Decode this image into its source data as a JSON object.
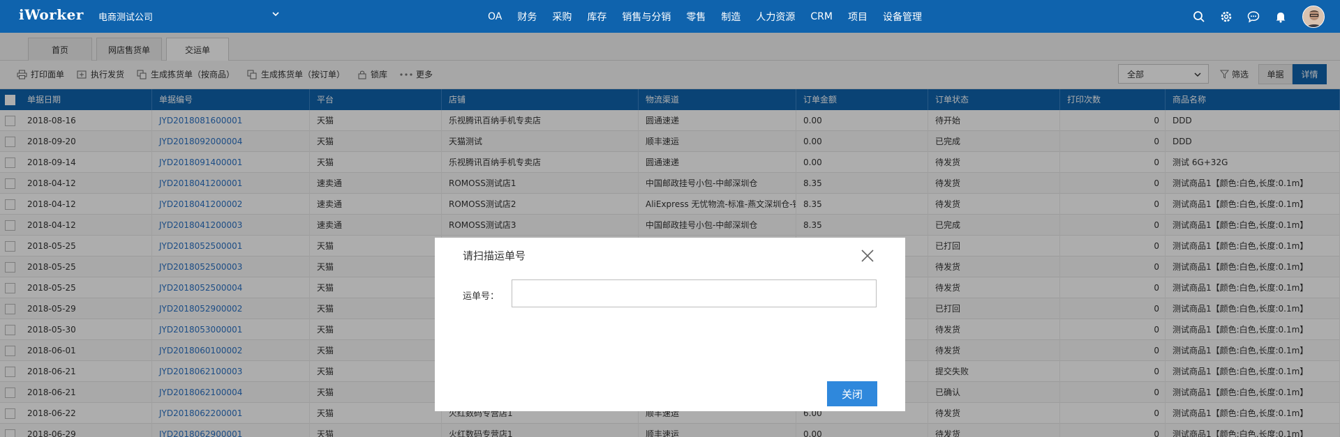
{
  "app": {
    "logo": "iWorker",
    "company": "电商测试公司"
  },
  "nav": [
    "OA",
    "财务",
    "采购",
    "库存",
    "销售与分销",
    "零售",
    "制造",
    "人力资源",
    "CRM",
    "项目",
    "设备管理"
  ],
  "tabs": [
    "首页",
    "网店售货单",
    "交运单"
  ],
  "toolbar": {
    "print": "打印面单",
    "ship": "执行发货",
    "pick_by_product": "生成拣货单（按商品）",
    "pick_by_order": "生成拣货单（按订单）",
    "lock": "锁库",
    "more": "更多",
    "filter_value": "全部",
    "screen": "筛选",
    "view_list": "单据",
    "view_detail": "详情"
  },
  "table": {
    "headers": [
      "单据日期",
      "单据编号",
      "平台",
      "店铺",
      "物流渠道",
      "订单金额",
      "订单状态",
      "打印次数",
      "商品名称"
    ],
    "rows": [
      [
        "2018-08-16",
        "JYD2018081600001",
        "天猫",
        "乐视腾讯百纳手机专卖店",
        "圆通速递",
        "0.00",
        "待开始",
        "0",
        "DDD"
      ],
      [
        "2018-09-20",
        "JYD2018092000004",
        "天猫",
        "天猫测试",
        "顺丰速运",
        "0.00",
        "已完成",
        "0",
        "DDD"
      ],
      [
        "2018-09-14",
        "JYD2018091400001",
        "天猫",
        "乐视腾讯百纳手机专卖店",
        "圆通速递",
        "0.00",
        "待发货",
        "0",
        "测试 6G+32G"
      ],
      [
        "2018-04-12",
        "JYD2018041200001",
        "速卖通",
        "ROMOSS测试店1",
        "中国邮政挂号小包-中邮深圳仓",
        "8.35",
        "待发货",
        "0",
        "测试商品1【颜色:白色,长度:0.1m】"
      ],
      [
        "2018-04-12",
        "JYD2018041200002",
        "速卖通",
        "ROMOSS测试店2",
        "AliExpress 无忧物流-标准-燕文深圳仓-钱",
        "8.35",
        "待发货",
        "0",
        "测试商品1【颜色:白色,长度:0.1m】"
      ],
      [
        "2018-04-12",
        "JYD2018041200003",
        "速卖通",
        "ROMOSS测试店3",
        "中国邮政挂号小包-中邮深圳仓",
        "8.35",
        "已完成",
        "0",
        "测试商品1【颜色:白色,长度:0.1m】"
      ],
      [
        "2018-05-25",
        "JYD2018052500001",
        "天猫",
        "",
        "",
        "",
        "已打回",
        "0",
        "测试商品1【颜色:白色,长度:0.1m】"
      ],
      [
        "2018-05-25",
        "JYD2018052500003",
        "天猫",
        "",
        "",
        "",
        "待发货",
        "0",
        "测试商品1【颜色:白色,长度:0.1m】"
      ],
      [
        "2018-05-25",
        "JYD2018052500004",
        "天猫",
        "",
        "",
        "",
        "待发货",
        "0",
        "测试商品1【颜色:白色,长度:0.1m】"
      ],
      [
        "2018-05-29",
        "JYD2018052900002",
        "天猫",
        "",
        "",
        "",
        "已打回",
        "0",
        "测试商品1【颜色:白色,长度:0.1m】"
      ],
      [
        "2018-05-30",
        "JYD2018053000001",
        "天猫",
        "",
        "",
        "",
        "待发货",
        "0",
        "测试商品1【颜色:白色,长度:0.1m】"
      ],
      [
        "2018-06-01",
        "JYD2018060100002",
        "天猫",
        "",
        "",
        "",
        "待发货",
        "0",
        "测试商品1【颜色:白色,长度:0.1m】"
      ],
      [
        "2018-06-21",
        "JYD2018062100003",
        "天猫",
        "",
        "",
        "",
        "提交失败",
        "0",
        "测试商品1【颜色:白色,长度:0.1m】"
      ],
      [
        "2018-06-21",
        "JYD2018062100004",
        "天猫",
        "",
        "",
        "",
        "已确认",
        "0",
        "测试商品1【颜色:白色,长度:0.1m】"
      ],
      [
        "2018-06-22",
        "JYD2018062200001",
        "天猫",
        "火红数码专营店1",
        "顺丰速运",
        "6.00",
        "待发货",
        "0",
        "测试商品1【颜色:白色,长度:0.1m】"
      ],
      [
        "2018-06-29",
        "JYD2018062900001",
        "天猫",
        "火红数码专营店1",
        "顺丰速运",
        "0.00",
        "待发货",
        "0",
        "测试商品1【颜色:白色,长度:0.1m】"
      ]
    ]
  },
  "modal": {
    "title": "请扫描运单号",
    "field_label": "运单号：",
    "field_value": "",
    "field_placeholder": "",
    "close_label": "关闭"
  },
  "colors": {
    "brand": "#0f63ad",
    "primary_button": "#2f88dc",
    "link": "#2b72c4"
  }
}
